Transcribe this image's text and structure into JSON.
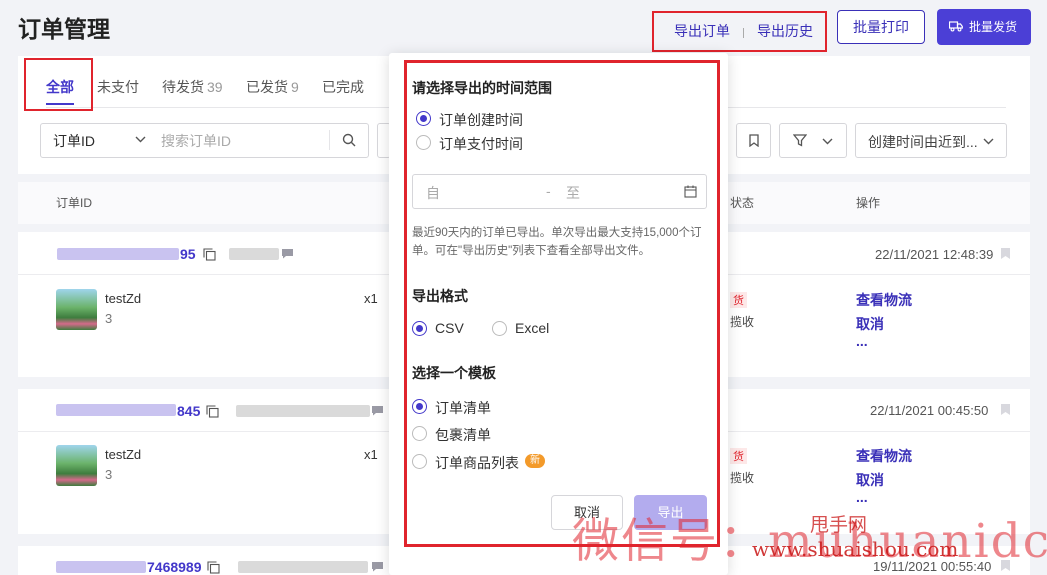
{
  "page": {
    "title": "订单管理"
  },
  "header": {
    "export_orders": "导出订单",
    "export_history": "导出历史",
    "batch_print": "批量打印",
    "batch_ship": "批量发货"
  },
  "tabs": [
    {
      "label": "全部",
      "count": ""
    },
    {
      "label": "未支付",
      "count": ""
    },
    {
      "label": "待发货",
      "count": "39"
    },
    {
      "label": "已发货",
      "count": "9"
    },
    {
      "label": "已完成",
      "count": ""
    }
  ],
  "filters": {
    "id_select": "订单ID",
    "search_placeholder": "搜索订单ID",
    "sort": "创建时间由近到..."
  },
  "table": {
    "col_order_id": "订单ID",
    "col_status": "状态",
    "col_actions": "操作"
  },
  "orders": [
    {
      "id_suffix": "95",
      "date": "22/11/2021 12:48:39",
      "product": "testZd",
      "variant": "3",
      "qty": "x1",
      "status_tag": "货",
      "status_sub": "揽收",
      "actions": [
        "查看物流",
        "取消",
        "..."
      ]
    },
    {
      "id_suffix": "845",
      "date": "22/11/2021 00:45:50",
      "product": "testZd",
      "variant": "3",
      "qty": "x1",
      "status_tag": "货",
      "status_sub": "揽收",
      "actions": [
        "查看物流",
        "取消",
        "..."
      ]
    },
    {
      "id_suffix": "7468989",
      "date": "19/11/2021 00:55:40"
    }
  ],
  "export_panel": {
    "time_title": "请选择导出的时间范围",
    "time_options": [
      "订单创建时间",
      "订单支付时间"
    ],
    "date_from": "自",
    "date_sep": "-",
    "date_to": "至",
    "hint": "最近90天内的订单已导出。单次导出最大支持15,000个订单。可在\"导出历史\"列表下查看全部导出文件。",
    "format_title": "导出格式",
    "formats": [
      "CSV",
      "Excel"
    ],
    "template_title": "选择一个模板",
    "templates": [
      "订单清单",
      "包裹清单",
      "订单商品列表"
    ],
    "new_badge": "新",
    "cancel": "取消",
    "export": "导出"
  },
  "watermark": {
    "main": "微信号：muhuanidc",
    "site": "甩手网",
    "url": "www.shuaishou.com"
  },
  "colors": {
    "primary": "#4338ca",
    "highlight": "#e0242d"
  }
}
